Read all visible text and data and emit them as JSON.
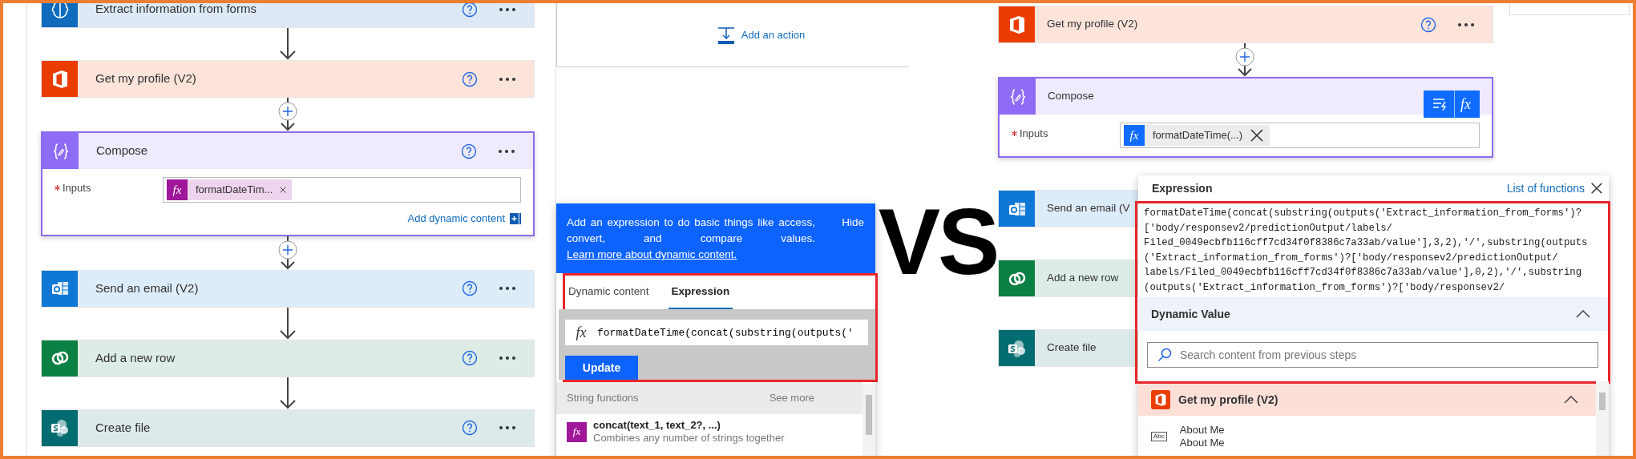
{
  "left": {
    "flow": [
      {
        "kind": "ai",
        "color": "#0f6cbd",
        "title": "Extract information from forms",
        "selected": false,
        "show_controls": true
      },
      {
        "kind": "arrow"
      },
      {
        "kind": "office",
        "color": "#eb3c00",
        "title": "Get my profile (V2)",
        "selected": false,
        "show_controls": true
      },
      {
        "kind": "insert"
      },
      {
        "kind": "compose",
        "color": "#8f6cf5",
        "title": "Compose",
        "selected": true,
        "show_controls": true,
        "inputs": {
          "label": "Inputs",
          "required": true,
          "token": {
            "icon": "fx",
            "color": "#a0179a",
            "text": "formatDateTim..."
          },
          "link": "Add dynamic content"
        }
      },
      {
        "kind": "insert"
      },
      {
        "kind": "outlook",
        "color": "#0f78d4",
        "title": "Send an email (V2)",
        "selected": false,
        "show_controls": true
      },
      {
        "kind": "arrow"
      },
      {
        "kind": "dataverse",
        "color": "#0b8043",
        "title": "Add a new row",
        "selected": false,
        "show_controls": true
      },
      {
        "kind": "arrow"
      },
      {
        "kind": "sharepoint",
        "color": "#036c70",
        "title": "Create file",
        "selected": false,
        "show_controls": true
      }
    ]
  },
  "middle": {
    "add_action": "Add an action",
    "popup": {
      "info": "Add an expression to do basic things like access, convert, and compare values.",
      "info_link": "Learn more about dynamic content.",
      "hide": "Hide",
      "highlight": true,
      "tabs": [
        {
          "label": "Dynamic content",
          "selected": false
        },
        {
          "label": "Expression",
          "selected": true
        }
      ],
      "expression": {
        "icon": "fx",
        "value": "formatDateTime(concat(substring(outputs('"
      },
      "button": "Update",
      "section": {
        "title": "String functions",
        "more": "See more"
      },
      "functions": [
        {
          "icon": "fx",
          "name": "concat(text_1, text_2?, ...)",
          "description": "Combines any number of strings together"
        }
      ]
    }
  },
  "vs": "VS",
  "right": {
    "flow": [
      {
        "kind": "office",
        "color": "#eb3c00",
        "title": "Get my profile (V2)",
        "selected": false,
        "show_controls": true
      },
      {
        "kind": "insert"
      },
      {
        "kind": "compose",
        "color": "#8f6cf5",
        "title": "Compose",
        "selected": true,
        "show_controls": false,
        "inputs": {
          "label": "Inputs",
          "required": true,
          "token": {
            "icon": "fx",
            "color": "#0f6cff",
            "text": "formatDateTime(...)"
          },
          "toolbar": [
            {
              "kind": "dynamic"
            },
            {
              "kind": "expression",
              "text": "fx"
            }
          ]
        }
      },
      {
        "kind": "outlook",
        "color": "#0f78d4",
        "title": "Send an email (V",
        "selected": false,
        "show_controls": false
      },
      {
        "kind": "dataverse",
        "color": "#0b8043",
        "title": "Add a new row",
        "selected": false,
        "show_controls": false
      },
      {
        "kind": "sharepoint",
        "color": "#036c70",
        "title": "Create file",
        "selected": false,
        "show_controls": false
      }
    ],
    "expression_panel": {
      "title": "Expression",
      "link": "List of functions",
      "highlight": true,
      "lines": [
        "formatDateTime(concat(substring(outputs('Extract_information_from_forms')?",
        "['body/responsev2/predictionOutput/labels/",
        "Filed_0049ecbfb116cff7cd34f0f8386c7a33ab/value'],3,2),'/',substring(outputs",
        "('Extract_information_from_forms')?['body/responsev2/predictionOutput/",
        "labels/Filed_0049ecbfb116cff7cd34f0f8386c7a33ab/value'],0,2),'/',substring",
        "(outputs('Extract_information_from_forms')?['body/responsev2/"
      ],
      "dynamic_value": {
        "title": "Dynamic Value",
        "expanded": true
      },
      "search": {
        "placeholder": "Search content from previous steps"
      },
      "groups": [
        {
          "title": "Get my profile (V2)",
          "kind": "office",
          "color": "#eb3c00",
          "expanded": true,
          "items": [
            {
              "type": "Abc",
              "name": "About Me",
              "description": "About Me"
            }
          ]
        }
      ]
    }
  }
}
